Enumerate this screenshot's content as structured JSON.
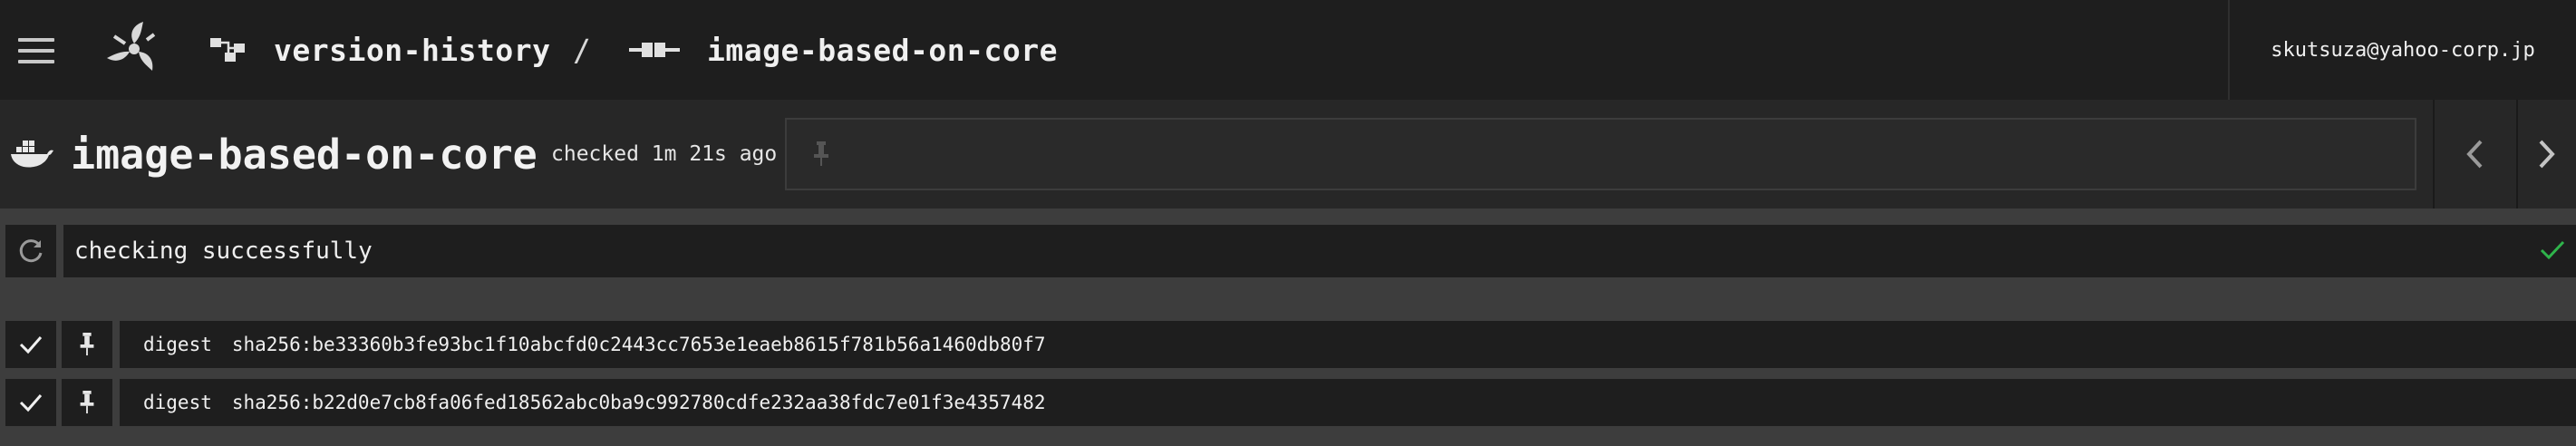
{
  "topbar": {
    "pipeline_name": "version-history",
    "separator": "/",
    "resource_name": "image-based-on-core",
    "user_email": "skutsuza@yahoo-corp.jp",
    "icons": [
      "hamburger-icon",
      "concourse-logo",
      "pipeline-icon",
      "resource-icon"
    ]
  },
  "resource": {
    "type_icon": "docker-icon",
    "title": "image-based-on-core",
    "checked_text": "checked 1m 21s ago",
    "pin_icon": "pin-icon"
  },
  "check": {
    "status_text": "checking successfully",
    "status_color": "#2fb44b"
  },
  "versions": [
    {
      "key": "digest",
      "value": "sha256:be33360b3fe93bc1f10abcfd0c2443cc7653e1eaeb8615f781b56a1460db80f7",
      "enabled": true
    },
    {
      "key": "digest",
      "value": "sha256:b22d0e7cb8fa06fed18562abc0ba9c992780cdfe232aa38fdc7e01f3e4357482",
      "enabled": true
    }
  ],
  "colors": {
    "topbar_bg": "#1e1e1e",
    "page_bg": "#3d3d3d",
    "success": "#2fb44b"
  }
}
